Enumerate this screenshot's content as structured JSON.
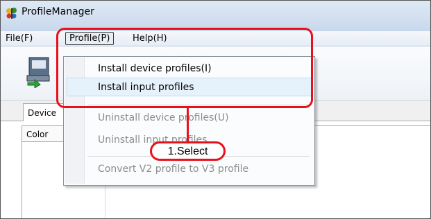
{
  "window": {
    "title": "ProfileManager"
  },
  "menubar": {
    "file": "File(F)",
    "profile": "Profile(P)",
    "help": "Help(H)"
  },
  "tabs": {
    "device": "Device"
  },
  "list": {
    "column_color": "Color"
  },
  "profile_menu": {
    "install_device": "Install device profiles(I)",
    "install_input": "Install input profiles",
    "uninstall_device": "Uninstall device profiles(U)",
    "uninstall_input": "Uninstall input profiles",
    "convert": "Convert V2 profile to V3 profile"
  },
  "annotation": {
    "step_label": "1.Select"
  },
  "colors": {
    "callout": "#e8101a",
    "highlight": "#e6f2fb"
  },
  "icons": {
    "app": "butterfly-app-icon",
    "toolbar": "install-printer-icon"
  }
}
